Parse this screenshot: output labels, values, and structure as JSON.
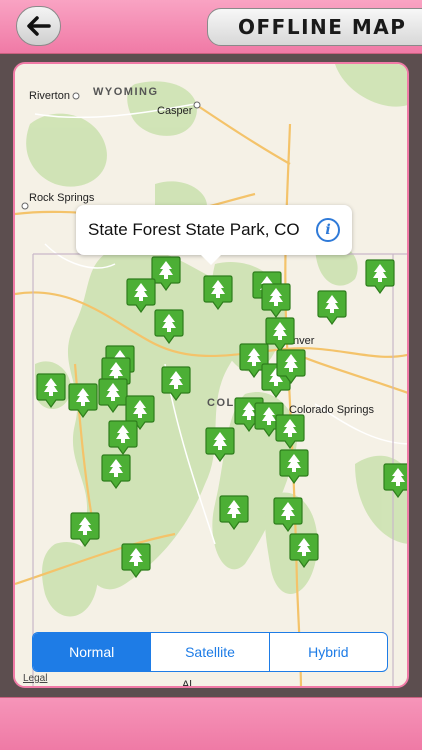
{
  "header": {
    "back_icon": "arrow-left-icon",
    "title": "OFFLINE MAP"
  },
  "map": {
    "labels": {
      "riverton": "Riverton",
      "wyoming": "WYOMING",
      "casper": "Casper",
      "rock_springs": "Rock Springs",
      "denver": "Denver",
      "colorado": "COLO",
      "colorado_springs": "Colorado Springs",
      "al": "Al"
    },
    "callout": {
      "title": "State Forest State Park, CO",
      "info_icon": "info-icon"
    },
    "marker_icon": "tree-icon",
    "marker_color": "#4caf35",
    "legal": "Legal"
  },
  "map_type": {
    "options": [
      "Normal",
      "Satellite",
      "Hybrid"
    ],
    "selected": "Normal"
  },
  "colors": {
    "accent_pink": "#f07aa6",
    "ios_blue": "#1e7ce6",
    "map_bg": "#f5f1e6",
    "park_green": "#cfe3b4"
  }
}
